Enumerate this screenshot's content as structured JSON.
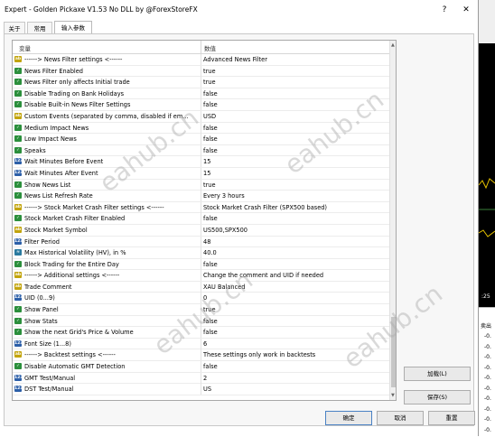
{
  "window": {
    "title": "Expert - Golden Pickaxe V1.53 No DLL by @ForexStoreFX",
    "help_label": "?",
    "close_label": "✕"
  },
  "tabs": [
    "关于",
    "常用",
    "输入参数"
  ],
  "grid": {
    "columns": {
      "variable": "变量",
      "value": "数值"
    },
    "rows": [
      {
        "icon": "ab",
        "name": "------> News Filter settings <------",
        "value": "Advanced News Filter"
      },
      {
        "icon": "chk",
        "name": "News Filter Enabled",
        "value": "true"
      },
      {
        "icon": "chk",
        "name": "News Filter only affects Initial trade",
        "value": "true"
      },
      {
        "icon": "chk",
        "name": "Disable Trading on Bank Holidays",
        "value": "false"
      },
      {
        "icon": "chk",
        "name": "Disable Built-in News Filter Settings",
        "value": "false"
      },
      {
        "icon": "ab",
        "name": "Custom Events (separated by comma, disabled if em...",
        "value": "USD"
      },
      {
        "icon": "chk",
        "name": "Medium Impact News",
        "value": "false"
      },
      {
        "icon": "chk",
        "name": "Low Impact News",
        "value": "false"
      },
      {
        "icon": "chk",
        "name": "Speaks",
        "value": "false"
      },
      {
        "icon": "v123",
        "name": "Wait Minutes Before Event",
        "value": "15"
      },
      {
        "icon": "v123",
        "name": "Wait Minutes After Event",
        "value": "15"
      },
      {
        "icon": "chk",
        "name": "Show News List",
        "value": "true"
      },
      {
        "icon": "chk",
        "name": "News List Refresh Rate",
        "value": "Every 3 hours"
      },
      {
        "icon": "ab",
        "name": "------> Stock Market Crash Filter settings <------",
        "value": "Stock Market Crash Filter (SPX500 based)"
      },
      {
        "icon": "chk",
        "name": "Stock Market Crash Filter Enabled",
        "value": "false"
      },
      {
        "icon": "ab",
        "name": "Stock Market Symbol",
        "value": "US500,SPX500"
      },
      {
        "icon": "v123",
        "name": "Filter Period",
        "value": "48"
      },
      {
        "icon": "dbl",
        "name": "Max Historical Volatility (HV), in %",
        "value": "40.0"
      },
      {
        "icon": "chk",
        "name": "Block Trading for the Entire Day",
        "value": "false"
      },
      {
        "icon": "ab",
        "name": "------> Additional settings <------",
        "value": "Change the comment and UID if needed"
      },
      {
        "icon": "ab",
        "name": "Trade Comment",
        "value": "XAU Balanced"
      },
      {
        "icon": "v123",
        "name": "UID (0...9)",
        "value": "0"
      },
      {
        "icon": "chk",
        "name": "Show Panel",
        "value": "true"
      },
      {
        "icon": "chk",
        "name": "Show Stats",
        "value": "false"
      },
      {
        "icon": "chk",
        "name": "Show the next Grid's Price & Volume",
        "value": "false"
      },
      {
        "icon": "v123",
        "name": "Font Size (1...8)",
        "value": "6"
      },
      {
        "icon": "ab",
        "name": "------> Backtest settings <------",
        "value": "These settings only work in backtests"
      },
      {
        "icon": "chk",
        "name": "Disable Automatic GMT Detection",
        "value": "false"
      },
      {
        "icon": "v123",
        "name": "GMT Test/Manual",
        "value": "2"
      },
      {
        "icon": "v123",
        "name": "DST Test/Manual",
        "value": "US"
      }
    ]
  },
  "buttons": {
    "load": "加载(L)",
    "save": "保存(S)",
    "ok": "确定",
    "cancel": "取消",
    "reset": "重置"
  },
  "icons": {
    "ab": "ab",
    "v123": "123",
    "chk": "✓",
    "dbl": "≈"
  },
  "background": {
    "time_label": ":25",
    "header": "卖出",
    "values": [
      "-0.",
      "-0.",
      "-0.",
      "-0.",
      "-0.",
      "-0.",
      "-0.",
      "-0.",
      "-0.",
      "-0."
    ]
  },
  "watermark": "eahub.cn",
  "colors": {
    "ab_icon": "#c2a40c",
    "int_icon": "#2c5fa8",
    "bool_icon": "#2b8f3c",
    "double_icon": "#2a7a9f"
  }
}
